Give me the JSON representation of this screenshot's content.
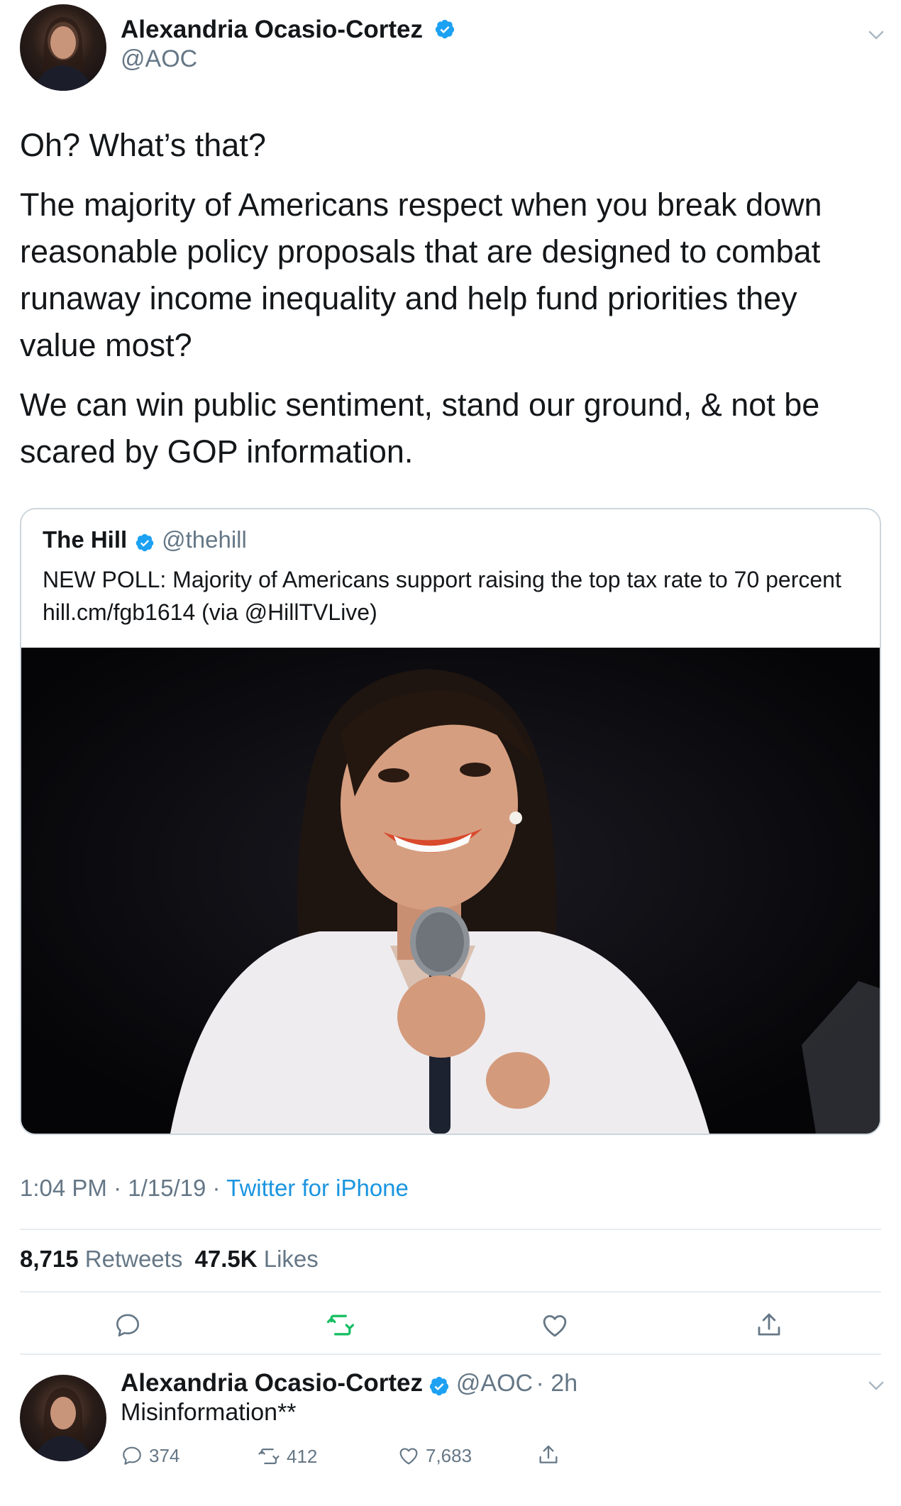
{
  "tweet": {
    "author_name": "Alexandria Ocasio-Cortez",
    "author_handle": "@AOC",
    "paragraphs": [
      "Oh? What’s that?",
      "The majority of Americans respect when you break down reasonable policy proposals that are designed to combat runaway income inequality and help fund priorities they value most?",
      "We can win public sentiment, stand our ground, & not be scared by GOP information."
    ],
    "quoted": {
      "name": "The Hill",
      "handle": "@thehill",
      "text": "NEW POLL: Majority of Americans support raising the top tax rate to 70 percent hill.cm/fgb1614 (via @HillTVLive)"
    },
    "time": "1:04 PM",
    "date": "1/15/19",
    "sep": "·",
    "client": "Twitter for iPhone",
    "retweets_count": "8,715",
    "retweets_label": "Retweets",
    "likes_count": "47.5K",
    "likes_label": "Likes",
    "actions": [
      "reply-icon",
      "retweet-icon",
      "like-icon",
      "share-icon"
    ]
  },
  "reply": {
    "author_name": "Alexandria Ocasio-Cortez",
    "author_handle": "@AOC",
    "age": "· 2h",
    "text": "Misinformation**",
    "reply_count": "374",
    "retweet_count": "412",
    "like_count": "7,683"
  },
  "colors": {
    "text": "#14171a",
    "secondary": "#657786",
    "link": "#1b95e0",
    "retweet_active": "#17bf63",
    "verified": "#1da1f2",
    "divider": "#e6ecf0"
  }
}
